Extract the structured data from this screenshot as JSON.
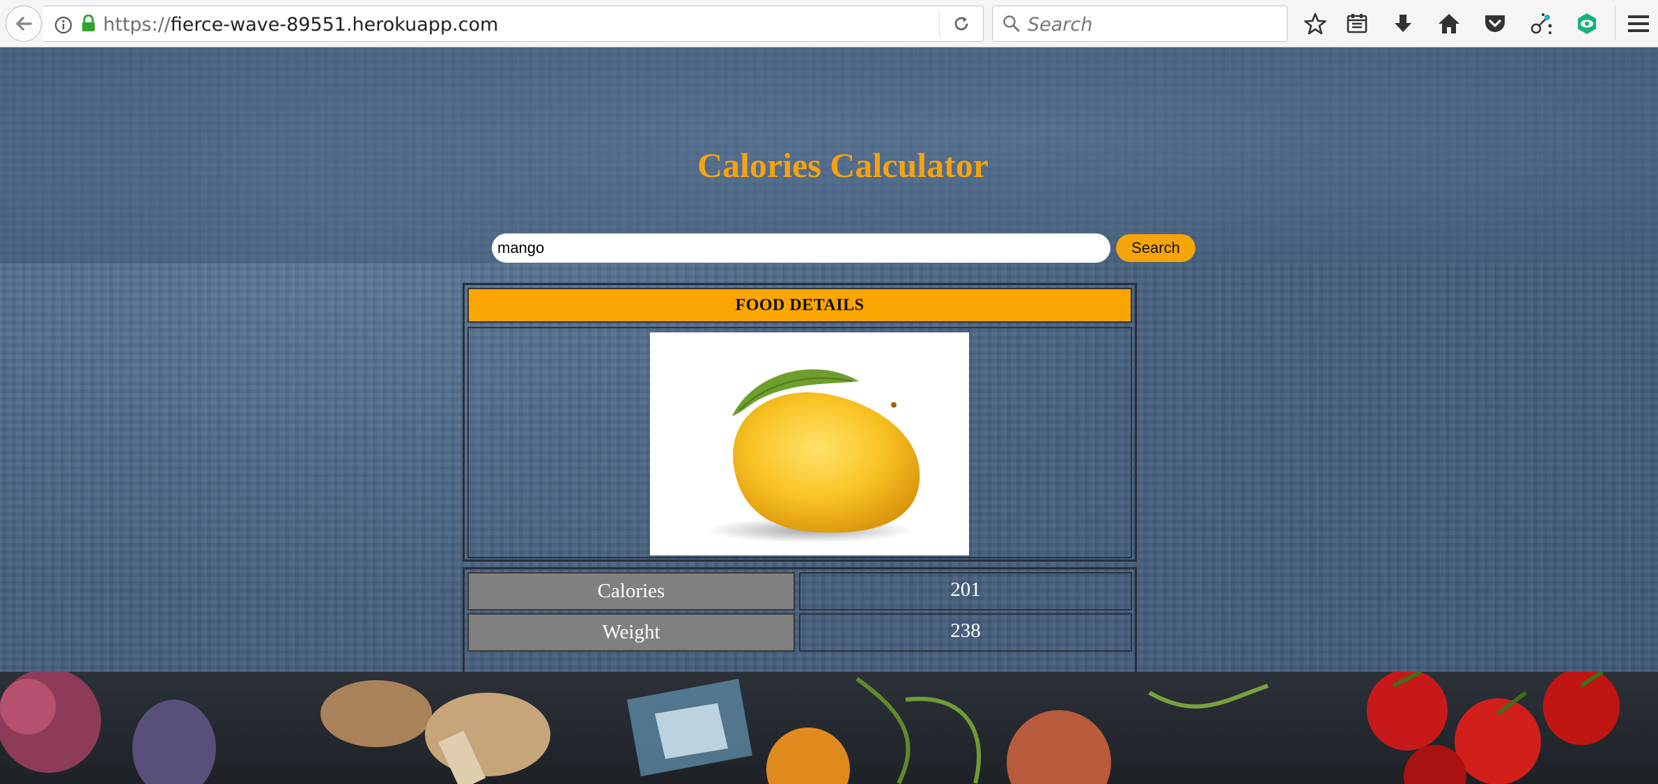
{
  "browser": {
    "url_protocol": "https://",
    "url_host": "fierce-wave-89551.herokuapp.com",
    "search_placeholder": "Search"
  },
  "page": {
    "title": "Calories Calculator",
    "search": {
      "value": "mango",
      "button_label": "Search"
    },
    "food_details": {
      "header": "FOOD DETAILS",
      "image": "mango",
      "rows": [
        {
          "label": "Calories",
          "value": "201"
        },
        {
          "label": "Weight",
          "value": "238"
        }
      ]
    }
  },
  "colors": {
    "accent": "#f5a20f",
    "header_bg": "#faa500",
    "label_bg": "#808080",
    "page_bg": "#4a6585"
  }
}
